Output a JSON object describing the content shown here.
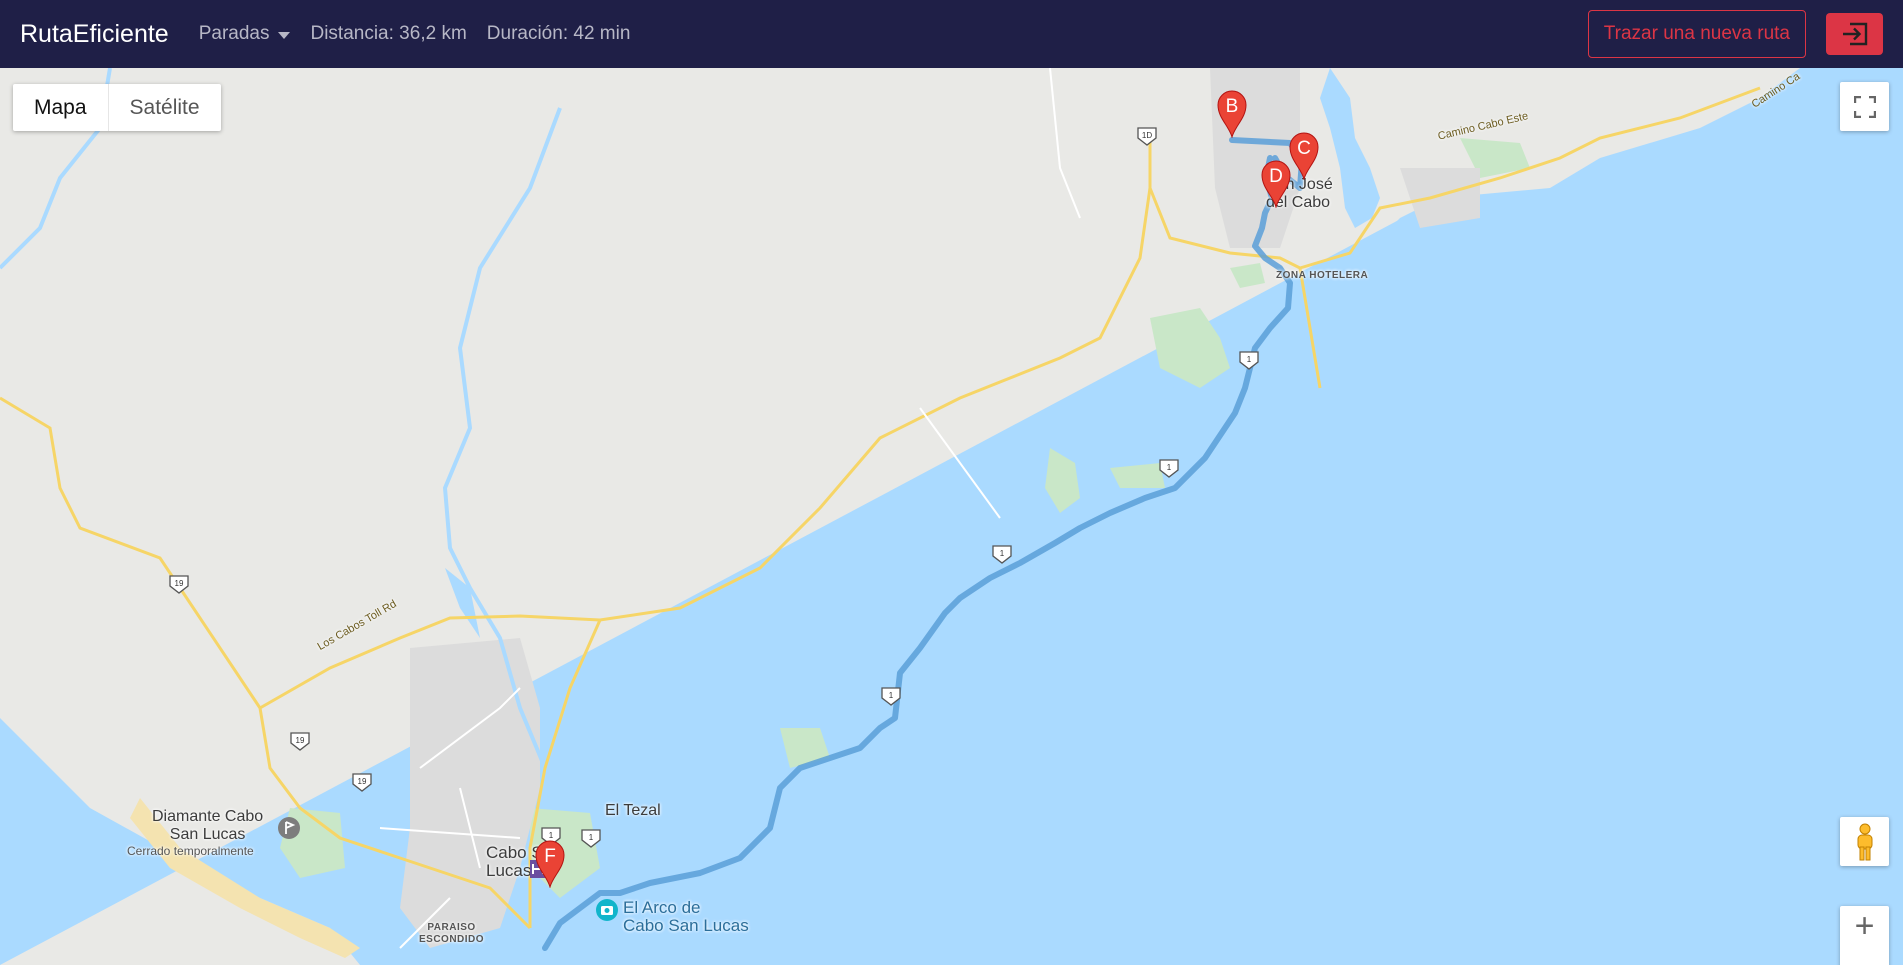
{
  "navbar": {
    "brand": "RutaEficiente",
    "stops_menu": "Paradas",
    "distance": "Distancia: 36,2 km",
    "duration": "Duración: 42 min",
    "new_route_button": "Trazar una nueva ruta",
    "logout_icon": "logout-icon"
  },
  "map": {
    "map_type": {
      "map": "Mapa",
      "satellite": "Satélite"
    },
    "labels": {
      "san_jose": "San José\ndel Cabo",
      "zona_hotelera": "ZONA HOTELERA",
      "camino_cabo_este": "Camino Cabo Este",
      "camino_ca": "Camino Ca",
      "los_cabos_toll": "Los Cabos Toll Rd",
      "el_tezal": "El Tezal",
      "cabo_san_lucas": "Cabo San\nLucas",
      "el_arco": "El Arco de\nCabo San Lucas",
      "diamante": "Diamante Cabo\nSan Lucas",
      "cerrado": "Cerrado temporalmente",
      "paraiso": "PARAISO\nESCONDIDO"
    },
    "route_shields": [
      "1D",
      "19",
      "19",
      "19",
      "1",
      "1",
      "1",
      "1",
      "1",
      "1"
    ],
    "markers": [
      "B",
      "C",
      "D",
      "F"
    ],
    "colors": {
      "route": "#5b9fd8",
      "marker": "#ea4335",
      "water": "#aadaff",
      "land": "#e9e9e6",
      "navbar": "#1f1f47",
      "danger": "#dc3545"
    },
    "controls": {
      "fullscreen": "fullscreen-icon",
      "pegman": "pegman-icon",
      "zoom_in": "+"
    }
  }
}
